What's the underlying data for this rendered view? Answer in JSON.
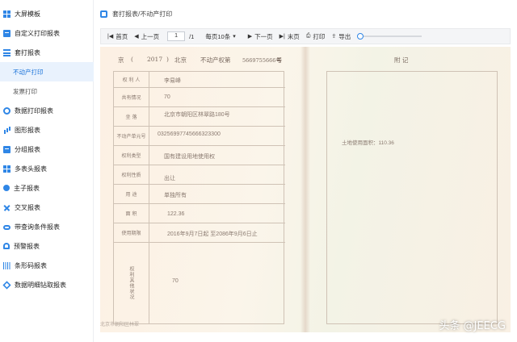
{
  "sidebar": {
    "items": [
      {
        "label": "大屏模板",
        "icon": "dashboard-icon"
      },
      {
        "label": "自定义打印报表",
        "icon": "print-template-icon"
      },
      {
        "label": "套打报表",
        "icon": "overlay-report-icon"
      },
      {
        "label": "不动产打印",
        "icon": ""
      },
      {
        "label": "发票打印",
        "icon": ""
      },
      {
        "label": "数据打印报表",
        "icon": "data-print-icon"
      },
      {
        "label": "图形报表",
        "icon": "chart-icon"
      },
      {
        "label": "分组报表",
        "icon": "group-icon"
      },
      {
        "label": "多表头报表",
        "icon": "multi-header-icon"
      },
      {
        "label": "主子报表",
        "icon": "master-detail-icon"
      },
      {
        "label": "交叉报表",
        "icon": "cross-report-icon"
      },
      {
        "label": "带查询条件报表",
        "icon": "query-icon"
      },
      {
        "label": "预警报表",
        "icon": "alert-icon"
      },
      {
        "label": "条形码报表",
        "icon": "barcode-icon"
      },
      {
        "label": "数据明细钻取报表",
        "icon": "drilldown-icon"
      }
    ]
  },
  "breadcrumb": {
    "text": "套打报表/不动产打印"
  },
  "toolbar": {
    "first": "首页",
    "prev": "上一页",
    "page_value": "1",
    "page_total": "/1",
    "page_size": "每页10条",
    "next": "下一页",
    "last": "末页",
    "print": "打印",
    "export": "导出",
    "zoom_level": 0
  },
  "report": {
    "header_city": "京",
    "header_paren_open": "(",
    "header_year": "2017",
    "header_paren_close": ")",
    "header_district": "北京",
    "header_title": "不动产权第",
    "header_number": "5669755666号",
    "header_suffix": "号",
    "appendix_title": "附     记",
    "rows": [
      {
        "label": "权 利 人",
        "value": "李易峰"
      },
      {
        "label": "共有情况",
        "value": "70"
      },
      {
        "label": "坐    落",
        "value": "北京市朝阳区林翠路180号"
      },
      {
        "label": "不动产单元号",
        "value": "03256997745666323300"
      },
      {
        "label": "权利类型",
        "value": "国有建设用地使用权"
      },
      {
        "label": "权利性质",
        "value": "出让"
      },
      {
        "label": "用    途",
        "value": "单独所有"
      },
      {
        "label": "面    积",
        "value": "122.36"
      },
      {
        "label": "使用期限",
        "value": "2016年9月7日起 至2086年9月6日止"
      },
      {
        "label": "权利其他状况",
        "value": "70"
      }
    ],
    "appendix_note": "土地使用面积：110.36",
    "footnote": "北京市朝阳区林翠"
  },
  "watermark": "头条 @JEECG",
  "colors": {
    "accent": "#2f86e6",
    "active_bg": "#e9f2fd"
  }
}
